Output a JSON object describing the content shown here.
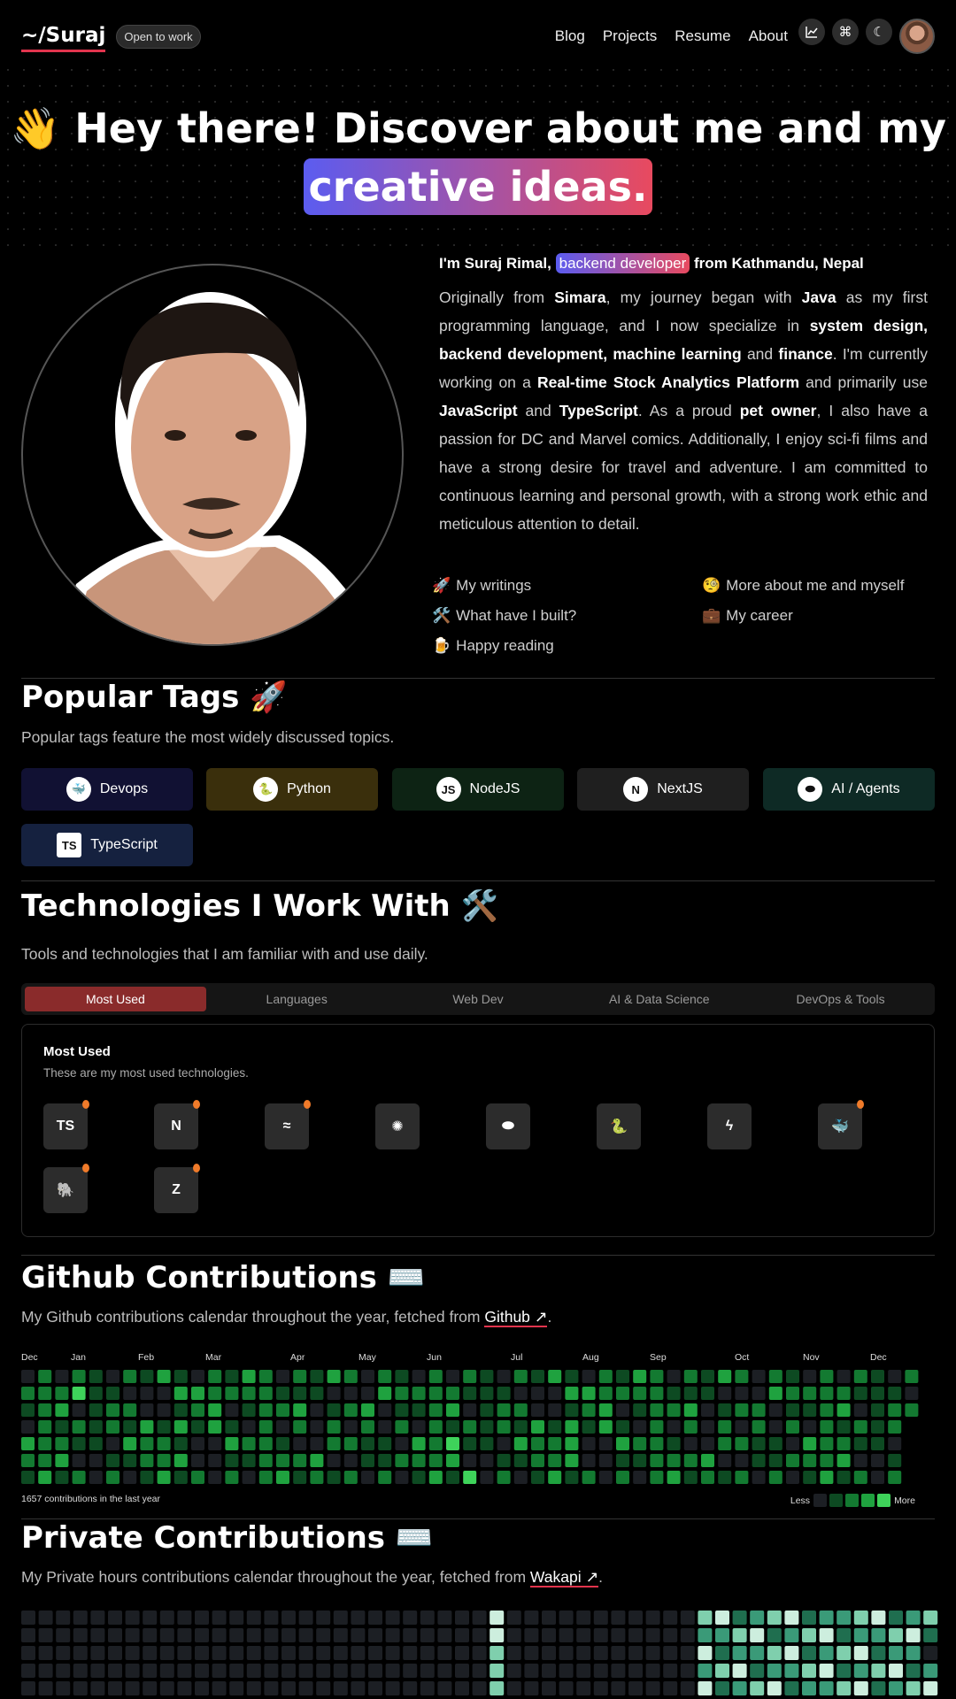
{
  "nav": {
    "logo": "~/Suraj",
    "status": "Open to work",
    "links": [
      "Blog",
      "Projects",
      "Resume",
      "About"
    ]
  },
  "hero": {
    "line1": "Hey there! Discover about me and my",
    "highlight": "creative ideas."
  },
  "intro": {
    "prefix": "I'm Suraj Rimal,",
    "role": "backend developer",
    "suffix": "from Kathmandu, Nepal",
    "bio_parts": [
      [
        "Originally from ",
        false
      ],
      [
        "Simara",
        true
      ],
      [
        ", my journey began with ",
        false
      ],
      [
        "Java",
        true
      ],
      [
        " as my first programming language, and I now specialize in ",
        false
      ],
      [
        "system design, backend development, machine learning",
        true
      ],
      [
        " and ",
        false
      ],
      [
        "finance",
        true
      ],
      [
        ". I'm currently working on a ",
        false
      ],
      [
        "Real-time Stock Analytics Platform",
        true
      ],
      [
        " and primarily use ",
        false
      ],
      [
        "JavaScript",
        true
      ],
      [
        " and ",
        false
      ],
      [
        "TypeScript",
        true
      ],
      [
        ". As a proud ",
        false
      ],
      [
        "pet owner",
        true
      ],
      [
        ", I also have a passion for DC and Marvel comics. Additionally, I enjoy sci-fi films and have a strong desire for travel and adventure. I am committed to continuous learning and personal growth, with a strong work ethic and meticulous attention to detail.",
        false
      ]
    ]
  },
  "quick_links": [
    {
      "emoji": "🚀",
      "label": "My writings"
    },
    {
      "emoji": "🧐",
      "label": "More about me and myself"
    },
    {
      "emoji": "🛠️",
      "label": "What have I built?"
    },
    {
      "emoji": "💼",
      "label": "My career"
    },
    {
      "emoji": "🍺",
      "label": "Happy reading"
    }
  ],
  "tags_section": {
    "title": "Popular Tags 🚀",
    "subtitle": "Popular tags feature the most widely discussed topics.",
    "tags": [
      {
        "label": "Devops",
        "icon": "docker-icon",
        "bg": "#111133"
      },
      {
        "label": "Python",
        "icon": "python-icon",
        "bg": "#3a2f0c"
      },
      {
        "label": "NodeJS",
        "icon": "nodejs-icon",
        "bg": "#0d2314"
      },
      {
        "label": "NextJS",
        "icon": "nextjs-icon",
        "bg": "#1f1f1f"
      },
      {
        "label": "AI / Agents",
        "icon": "toggle-icon",
        "bg": "#0e2a25"
      },
      {
        "label": "TypeScript",
        "icon": "typescript-icon",
        "bg": "#15213f"
      }
    ]
  },
  "tech_section": {
    "title": "Technologies I Work With 🛠️",
    "subtitle": "Tools and technologies that I am familiar with and use daily.",
    "tabs": [
      "Most Used",
      "Languages",
      "Web Dev",
      "AI & Data Science",
      "DevOps & Tools"
    ],
    "active_tab": "Most Used",
    "card_title": "Most Used",
    "card_subtitle": "These are my most used technologies.",
    "icons": [
      {
        "name": "typescript-icon",
        "glyph": "TS",
        "fire": true
      },
      {
        "name": "nextjs-icon",
        "glyph": "N",
        "fire": true
      },
      {
        "name": "tailwind-icon",
        "glyph": "≈",
        "fire": true
      },
      {
        "name": "openai-icon",
        "glyph": "✺",
        "fire": false
      },
      {
        "name": "toggle-icon",
        "glyph": "⬬",
        "fire": false
      },
      {
        "name": "python-icon",
        "glyph": "🐍",
        "fire": false
      },
      {
        "name": "fastapi-icon",
        "glyph": "ϟ",
        "fire": false
      },
      {
        "name": "docker-icon",
        "glyph": "🐳",
        "fire": true
      },
      {
        "name": "postgresql-icon",
        "glyph": "🐘",
        "fire": true
      },
      {
        "name": "zustand-icon",
        "glyph": "Z",
        "fire": true
      }
    ]
  },
  "github_section": {
    "title": "Github Contributions ⌨️",
    "subtitle_prefix": "My Github contributions calendar throughout the year, fetched from ",
    "link": "Github ↗",
    "months": [
      "Dec",
      "Jan",
      "Feb",
      "Mar",
      "Apr",
      "May",
      "Jun",
      "Jul",
      "Aug",
      "Sep",
      "Oct",
      "Nov",
      "Dec"
    ],
    "total": "1657 contributions in the last year",
    "legend_less": "Less",
    "legend_more": "More",
    "colors": [
      "#1c1f24",
      "#0d4a22",
      "#137a31",
      "#1fa23f",
      "#3ed35a"
    ]
  },
  "private_section": {
    "title": "Private Contributions ⌨️",
    "subtitle_prefix": "My Private hours contributions calendar throughout the year, fetched from ",
    "link": "Wakapi ↗",
    "colors": [
      "#1c1f24",
      "#1f6e4f",
      "#3a9a78",
      "#7fcfad",
      "#cdeede"
    ]
  }
}
